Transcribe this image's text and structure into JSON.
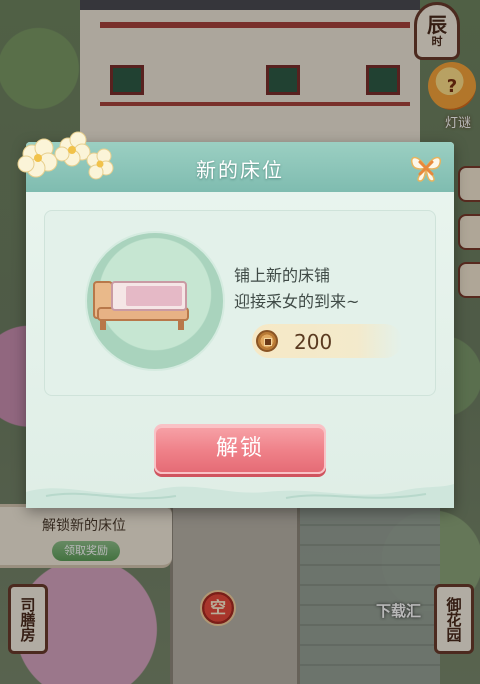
{
  "hud": {
    "clock_time": "辰",
    "clock_sub": "时",
    "lantern_label": "灯谜",
    "lantern_icon": "question-lantern-icon"
  },
  "dialog": {
    "title": "新的床位",
    "close_icon": "butterfly-close-icon",
    "description_line1": "铺上新的床铺",
    "description_line2": "迎接采女的到来~",
    "cost_icon": "coin-icon",
    "cost_value": "200",
    "unlock_label": "解锁"
  },
  "task": {
    "title": "解锁新的床位",
    "claim_label": "领取奖励"
  },
  "signs": {
    "left": "司膳房",
    "right": "御花园"
  },
  "map": {
    "empty_slot_label": "空"
  },
  "watermark": "下载汇",
  "colors": {
    "header": "#8cc6b9",
    "panel": "#e3f1ea",
    "unlock_button": "#ef8088",
    "accent_brown": "#6a3b2c"
  }
}
